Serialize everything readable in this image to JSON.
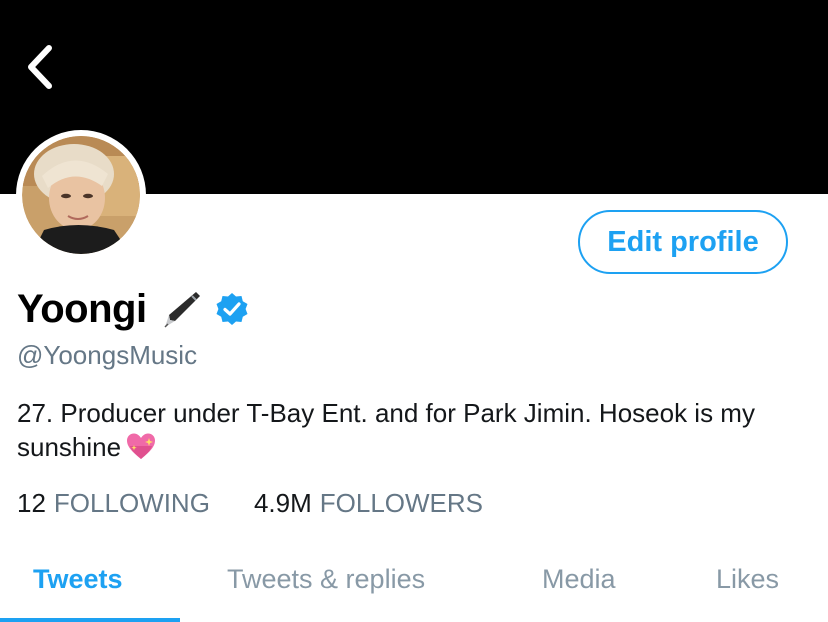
{
  "header": {
    "back_icon": "chevron-left-icon",
    "banner_color": "#000000"
  },
  "profile": {
    "display_name": "Yoongi",
    "name_emoji_icon": "fountain-pen-icon",
    "verified_icon": "verified-badge-icon",
    "handle": "@YoongsMusic",
    "bio_text": "27. Producer under T-Bay Ent. and for Park Jimin. Hoseok is my sunshine",
    "bio_emoji_icon": "sparkling-heart-icon",
    "edit_label": "Edit profile"
  },
  "stats": {
    "following_count": "12",
    "following_label": "FOLLOWING",
    "followers_count": "4.9M",
    "followers_label": "FOLLOWERS"
  },
  "tabs": [
    {
      "label": "Tweets",
      "active": true
    },
    {
      "label": "Tweets & replies",
      "active": false
    },
    {
      "label": "Media",
      "active": false
    },
    {
      "label": "Likes",
      "active": false
    }
  ],
  "colors": {
    "accent": "#1da1f2",
    "secondary_text": "#657786",
    "inactive_tab": "#8899a6"
  }
}
